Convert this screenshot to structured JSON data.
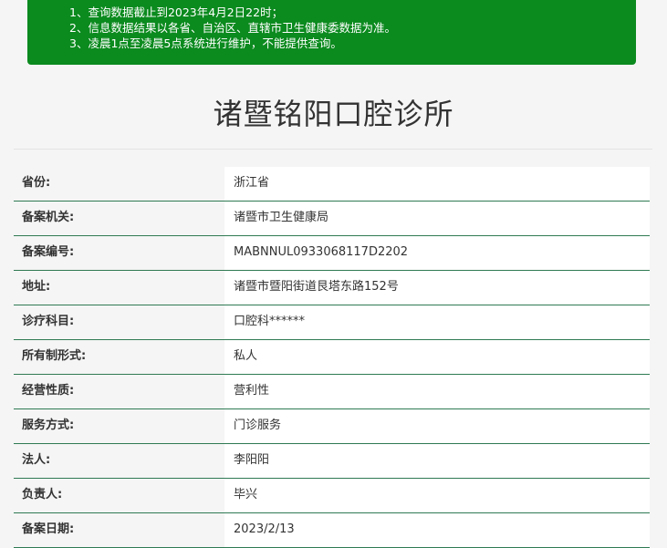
{
  "notice": {
    "lines": [
      "1、查询数据截止到2023年4月2日22时；",
      "2、信息数据结果以各省、自治区、直辖市卫生健康委数据为准。",
      "3、凌晨1点至凌晨5点系统进行维护，不能提供查询。"
    ]
  },
  "page_title": "诸暨铭阳口腔诊所",
  "records": [
    {
      "label": "省份:",
      "value": "浙江省"
    },
    {
      "label": "备案机关:",
      "value": "诸暨市卫生健康局"
    },
    {
      "label": "备案编号:",
      "value": "MABNNUL0933068117D2202"
    },
    {
      "label": "地址:",
      "value": "诸暨市暨阳街道艮塔东路152号"
    },
    {
      "label": "诊疗科目:",
      "value": "口腔科******"
    },
    {
      "label": "所有制形式:",
      "value": "私人"
    },
    {
      "label": "经营性质:",
      "value": "营利性"
    },
    {
      "label": "服务方式:",
      "value": "门诊服务"
    },
    {
      "label": "法人:",
      "value": "李阳阳"
    },
    {
      "label": "负责人:",
      "value": "毕兴"
    },
    {
      "label": "备案日期:",
      "value": "2023/2/13"
    }
  ],
  "colors": {
    "notice_bg": "#0b8a1e",
    "row_border": "#2f7a53"
  }
}
